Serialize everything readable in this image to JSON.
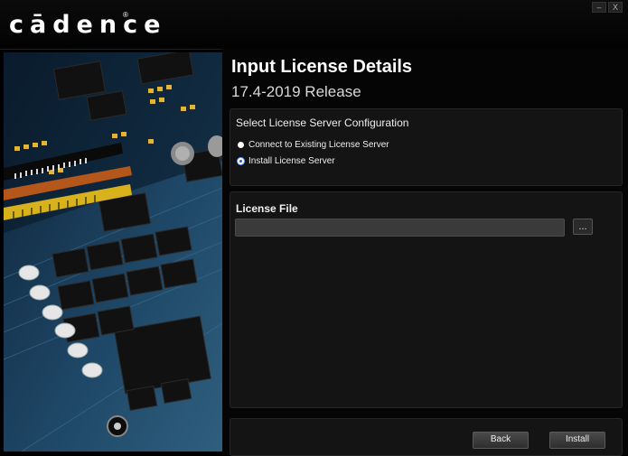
{
  "header": {
    "logo_text": "cādence",
    "logo_reg": "®",
    "minimize_label": "–",
    "close_label": "X"
  },
  "hero": {
    "image": "pcb-circuit-board-icon"
  },
  "main": {
    "title": "Input License Details",
    "subtitle": "17.4-2019 Release"
  },
  "config": {
    "title": "Select License Server Configuration",
    "options": [
      {
        "label": "Connect to Existing License Server",
        "selected": false
      },
      {
        "label": "Install License Server",
        "selected": true
      }
    ]
  },
  "license": {
    "title": "License File",
    "value": "",
    "placeholder": "",
    "browse_label": "..."
  },
  "footer": {
    "back_label": "Back",
    "install_label": "Install"
  },
  "colors": {
    "background": "#000000",
    "panel": "#141414",
    "radio_selected": "#1d5fd6"
  }
}
